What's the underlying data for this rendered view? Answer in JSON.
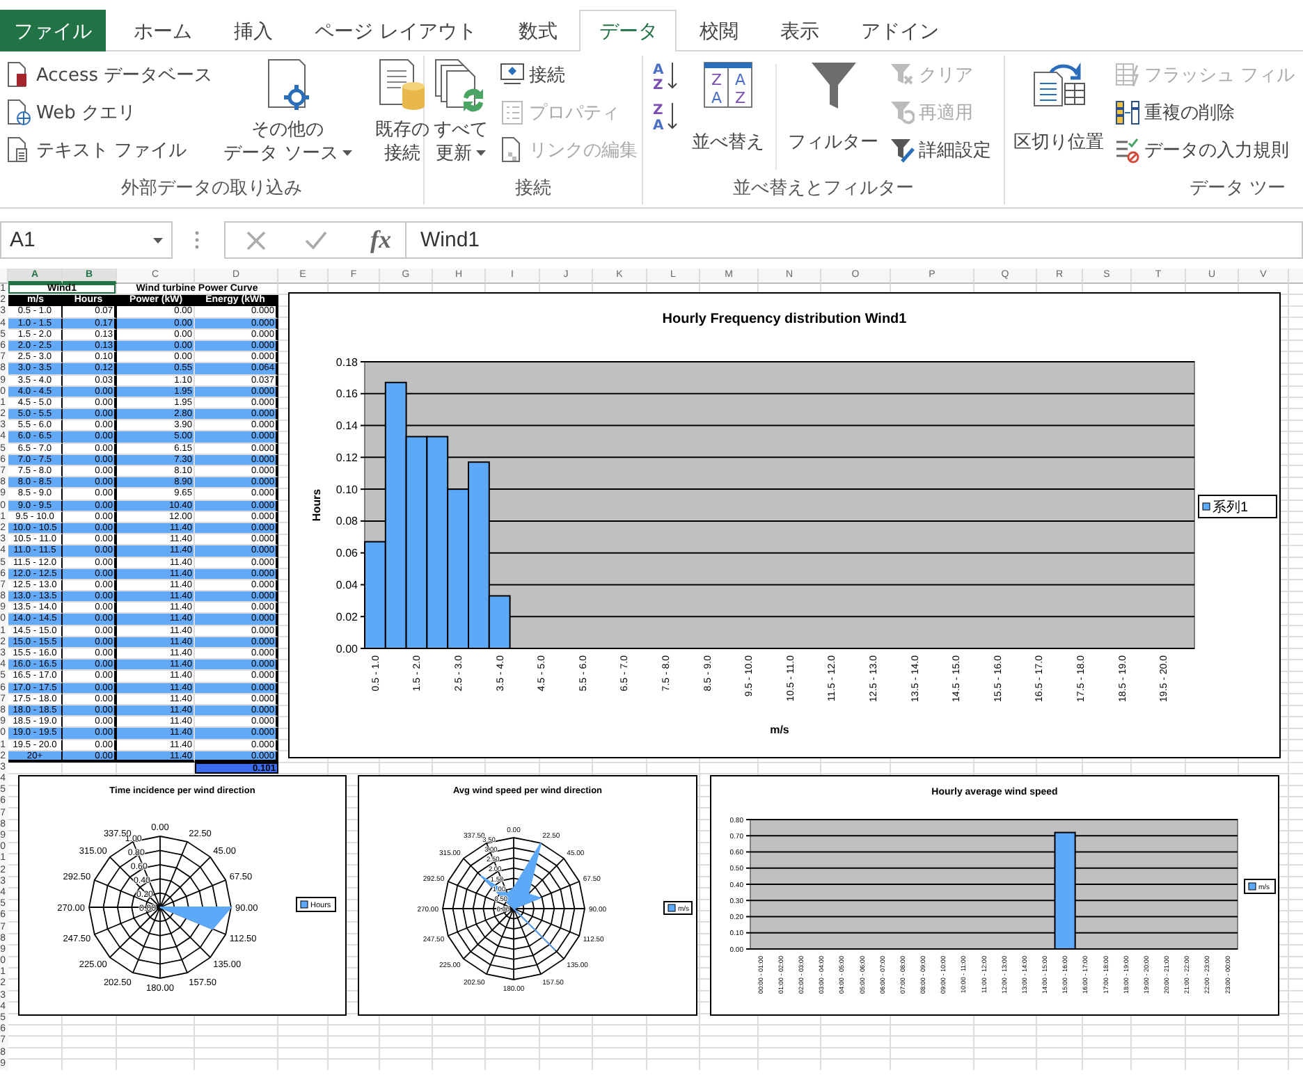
{
  "tabs": [
    {
      "label": "ファイル",
      "kind": "file",
      "selected": false
    },
    {
      "label": "ホーム",
      "kind": "tab",
      "selected": false
    },
    {
      "label": "挿入",
      "kind": "tab",
      "selected": false
    },
    {
      "label": "ページ レイアウト",
      "kind": "tab",
      "selected": false
    },
    {
      "label": "数式",
      "kind": "tab",
      "selected": false
    },
    {
      "label": "データ",
      "kind": "tab",
      "selected": true
    },
    {
      "label": "校閲",
      "kind": "tab",
      "selected": false
    },
    {
      "label": "表示",
      "kind": "tab",
      "selected": false
    },
    {
      "label": "アドイン",
      "kind": "tab",
      "selected": false
    }
  ],
  "ribbon": {
    "groups": [
      {
        "label": "外部データの取り込み",
        "items": [
          {
            "kind": "small",
            "label": "Access データベース",
            "disabled": false
          },
          {
            "kind": "small",
            "label": "Web クエリ",
            "disabled": false
          },
          {
            "kind": "small",
            "label": "テキスト ファイル",
            "disabled": false
          },
          {
            "kind": "large",
            "lines": [
              "その他の",
              "データ ソース"
            ],
            "dropdown": true,
            "disabled": false
          },
          {
            "kind": "large",
            "lines": [
              "既存の",
              "接続"
            ],
            "dropdown": false,
            "disabled": false
          }
        ]
      },
      {
        "label": "接続",
        "items": [
          {
            "kind": "large",
            "lines": [
              "すべて",
              "更新"
            ],
            "dropdown": true,
            "disabled": false
          },
          {
            "kind": "small",
            "label": "接続",
            "disabled": false
          },
          {
            "kind": "small",
            "label": "プロパティ",
            "disabled": true
          },
          {
            "kind": "small",
            "label": "リンクの編集",
            "disabled": true
          }
        ]
      },
      {
        "label": "並べ替えとフィルター",
        "items": [
          {
            "kind": "sort",
            "letters": [
              "A",
              "Z"
            ],
            "disabled": false
          },
          {
            "kind": "sort",
            "letters": [
              "Z",
              "A"
            ],
            "disabled": false
          },
          {
            "kind": "large",
            "lines": [
              "並べ替え"
            ],
            "letters": [
              "Z",
              "A",
              "A",
              "Z"
            ],
            "dropdown": false,
            "disabled": false
          },
          {
            "kind": "large",
            "lines": [
              "フィルター"
            ],
            "dropdown": false,
            "disabled": false
          },
          {
            "kind": "small",
            "label": "クリア",
            "disabled": true
          },
          {
            "kind": "small",
            "label": "再適用",
            "disabled": true
          },
          {
            "kind": "small",
            "label": "詳細設定",
            "disabled": false
          }
        ]
      },
      {
        "label": "データ ツー",
        "items": [
          {
            "kind": "large",
            "lines": [
              "区切り位置"
            ],
            "dropdown": false,
            "disabled": false
          },
          {
            "kind": "small",
            "label": "フラッシュ フィル",
            "disabled": true
          },
          {
            "kind": "small",
            "label": "重複の削除",
            "disabled": false
          },
          {
            "kind": "small",
            "label": "データの入力規則",
            "disabled": false
          }
        ]
      }
    ]
  },
  "formula_bar": {
    "name_box": "A1",
    "function_label": "fx",
    "value": "Wind1"
  },
  "sheet": {
    "columns": [
      {
        "label": "A",
        "selected": true
      },
      {
        "label": "B",
        "selected": true
      },
      {
        "label": "C",
        "selected": false
      },
      {
        "label": "D",
        "selected": false
      },
      {
        "label": "E",
        "selected": false
      },
      {
        "label": "F",
        "selected": false
      },
      {
        "label": "G",
        "selected": false
      },
      {
        "label": "H",
        "selected": false
      },
      {
        "label": "I",
        "selected": false
      },
      {
        "label": "J",
        "selected": false
      },
      {
        "label": "K",
        "selected": false
      },
      {
        "label": "L",
        "selected": false
      },
      {
        "label": "M",
        "selected": false
      },
      {
        "label": "N",
        "selected": false
      },
      {
        "label": "O",
        "selected": false
      },
      {
        "label": "P",
        "selected": false
      },
      {
        "label": "Q",
        "selected": false
      },
      {
        "label": "R",
        "selected": false
      },
      {
        "label": "S",
        "selected": false
      },
      {
        "label": "T",
        "selected": false
      },
      {
        "label": "U",
        "selected": false
      },
      {
        "label": "V",
        "selected": false
      }
    ],
    "row_headers": [
      "1",
      "2",
      "3",
      "4",
      "5",
      "6",
      "7",
      "8",
      "9",
      "0",
      "1",
      "2",
      "3",
      "4",
      "5",
      "6",
      "7",
      "8",
      "9",
      "0",
      "1",
      "2",
      "3",
      "4",
      "5",
      "6",
      "7",
      "8",
      "9",
      "0",
      "1",
      "2",
      "3",
      "4",
      "5",
      "6",
      "7",
      "8",
      "9",
      "0",
      "1",
      "2",
      "3",
      "4",
      "5",
      "6",
      "7",
      "8",
      "9",
      "0",
      "1",
      "2",
      "3",
      "4",
      "5",
      "6",
      "7",
      "8",
      "9",
      "0",
      "1",
      "2",
      "3",
      "4",
      "5",
      "6",
      "7",
      "8",
      "9"
    ],
    "table": {
      "titles": [
        {
          "text": "Wind1",
          "selected": true
        },
        {
          "text": "Wind turbine Power Curve",
          "selected": false
        }
      ],
      "columns": [
        "m/s",
        "Hours",
        "Power (kW)",
        "Energy (kWh"
      ],
      "rows": [
        [
          "0.5 - 1.0",
          "0.07",
          "0.00",
          "0.000"
        ],
        [
          "1.0 - 1.5",
          "0.17",
          "0.00",
          "0.000"
        ],
        [
          "1.5 - 2.0",
          "0.13",
          "0.00",
          "0.000"
        ],
        [
          "2.0 - 2.5",
          "0.13",
          "0.00",
          "0.000"
        ],
        [
          "2.5 - 3.0",
          "0.10",
          "0.00",
          "0.000"
        ],
        [
          "3.0 - 3.5",
          "0.12",
          "0.55",
          "0.064"
        ],
        [
          "3.5 - 4.0",
          "0.03",
          "1.10",
          "0.037"
        ],
        [
          "4.0 - 4.5",
          "0.00",
          "1.95",
          "0.000"
        ],
        [
          "4.5 - 5.0",
          "0.00",
          "1.95",
          "0.000"
        ],
        [
          "5.0 - 5.5",
          "0.00",
          "2.80",
          "0.000"
        ],
        [
          "5.5 - 6.0",
          "0.00",
          "3.90",
          "0.000"
        ],
        [
          "6.0 - 6.5",
          "0.00",
          "5.00",
          "0.000"
        ],
        [
          "6.5 - 7.0",
          "0.00",
          "6.15",
          "0.000"
        ],
        [
          "7.0 - 7.5",
          "0.00",
          "7.30",
          "0.000"
        ],
        [
          "7.5 - 8.0",
          "0.00",
          "8.10",
          "0.000"
        ],
        [
          "8.0 - 8.5",
          "0.00",
          "8.90",
          "0.000"
        ],
        [
          "8.5 - 9.0",
          "0.00",
          "9.65",
          "0.000"
        ],
        [
          "9.0 - 9.5",
          "0.00",
          "10.40",
          "0.000"
        ],
        [
          "9.5 - 10.0",
          "0.00",
          "12.00",
          "0.000"
        ],
        [
          "10.0 - 10.5",
          "0.00",
          "11.40",
          "0.000"
        ],
        [
          "10.5 - 11.0",
          "0.00",
          "11.40",
          "0.000"
        ],
        [
          "11.0 - 11.5",
          "0.00",
          "11.40",
          "0.000"
        ],
        [
          "11.5 - 12.0",
          "0.00",
          "11.40",
          "0.000"
        ],
        [
          "12.0 - 12.5",
          "0.00",
          "11.40",
          "0.000"
        ],
        [
          "12.5 - 13.0",
          "0.00",
          "11.40",
          "0.000"
        ],
        [
          "13.0 - 13.5",
          "0.00",
          "11.40",
          "0.000"
        ],
        [
          "13.5 - 14.0",
          "0.00",
          "11.40",
          "0.000"
        ],
        [
          "14.0 - 14.5",
          "0.00",
          "11.40",
          "0.000"
        ],
        [
          "14.5 - 15.0",
          "0.00",
          "11.40",
          "0.000"
        ],
        [
          "15.0 - 15.5",
          "0.00",
          "11.40",
          "0.000"
        ],
        [
          "15.5 - 16.0",
          "0.00",
          "11.40",
          "0.000"
        ],
        [
          "16.0 - 16.5",
          "0.00",
          "11.40",
          "0.000"
        ],
        [
          "16.5 - 17.0",
          "0.00",
          "11.40",
          "0.000"
        ],
        [
          "17.0 - 17.5",
          "0.00",
          "11.40",
          "0.000"
        ],
        [
          "17.5 - 18.0",
          "0.00",
          "11.40",
          "0.000"
        ],
        [
          "18.0 - 18.5",
          "0.00",
          "11.40",
          "0.000"
        ],
        [
          "18.5 - 19.0",
          "0.00",
          "11.40",
          "0.000"
        ],
        [
          "19.0 - 19.5",
          "0.00",
          "11.40",
          "0.000"
        ],
        [
          "19.5 - 20.0",
          "0.00",
          "11.40",
          "0.000"
        ],
        [
          "20+",
          "0.00",
          "11.40",
          "0.000"
        ]
      ],
      "total": "0.101"
    },
    "charts": [
      {
        "kind": "chart",
        "chart_data": {
          "type": "bar",
          "title": "Hourly Frequency distribution Wind1",
          "xlabel": "m/s",
          "ylabel": "Hours",
          "grid": true,
          "categories": [
            "0.5 - 1.0",
            null,
            "1.5 - 2.0",
            null,
            "2.5 - 3.0",
            null,
            "3.5 - 4.0",
            null,
            "4.5 - 5.0",
            null,
            "5.5 - 6.0",
            null,
            "6.5 - 7.0",
            null,
            "7.5 - 8.0",
            null,
            "8.5 - 9.0",
            null,
            "9.5 - 10.0",
            null,
            "10.5 - 11.0",
            null,
            "11.5 - 12.0",
            null,
            "12.5 - 13.0",
            null,
            "13.5 - 14.0",
            null,
            "14.5 - 15.0",
            null,
            "15.5 - 16.0",
            null,
            "16.5 - 17.0",
            null,
            "17.5 - 18.0",
            null,
            "18.5 - 19.0",
            null,
            "19.5 - 20.0",
            null
          ],
          "series": [
            {
              "name": "系列1",
              "color": "#5ea8f8",
              "values": [
                0.067,
                0.167,
                0.133,
                0.133,
                0.1,
                0.117,
                0.033,
                0,
                0,
                0,
                0,
                0,
                0,
                0,
                0,
                0,
                0,
                0,
                0,
                0,
                0,
                0,
                0,
                0,
                0,
                0,
                0,
                0,
                0,
                0,
                0,
                0,
                0,
                0,
                0,
                0,
                0,
                0,
                0,
                0
              ]
            }
          ],
          "ylim": [
            0,
            0.18
          ],
          "yticks": [
            {
              "value": 0,
              "label": "0.00"
            },
            {
              "value": 0.02,
              "label": "0.02"
            },
            {
              "value": 0.04,
              "label": "0.04"
            },
            {
              "value": 0.06,
              "label": "0.06"
            },
            {
              "value": 0.08,
              "label": "0.08"
            },
            {
              "value": 0.1,
              "label": "0.10"
            },
            {
              "value": 0.12,
              "label": "0.12"
            },
            {
              "value": 0.14,
              "label": "0.14"
            },
            {
              "value": 0.16,
              "label": "0.16"
            },
            {
              "value": 0.18,
              "label": "0.18"
            }
          ]
        }
      },
      {
        "kind": "radar",
        "title": "Time incidence per wind direction",
        "directions": [
          "0.00",
          "22.50",
          "45.00",
          "67.50",
          "90.00",
          "112.50",
          "135.00",
          "157.50",
          "180.00",
          "202.50",
          "225.00",
          "247.50",
          "270.00",
          "292.50",
          "315.00",
          "337.50"
        ],
        "rings": [
          "1.00",
          "0.80",
          "0.60",
          "0.40",
          "0.20",
          "0.00"
        ],
        "legend": "Hours"
      },
      {
        "kind": "radar",
        "title": "Avg wind speed per wind direction",
        "directions": [
          "0.00",
          "22.50",
          "45.00",
          "67.50",
          "90.00",
          "112.50",
          "135.00",
          "157.50",
          "180.00",
          "202.50",
          "225.00",
          "247.50",
          "270.00",
          "292.50",
          "315.00",
          "337.50"
        ],
        "rings": [
          "3.50",
          "3.00",
          "2.50",
          "2.00",
          "1.50",
          "1.00",
          "0.50",
          "0.00"
        ],
        "legend": "m/s"
      },
      {
        "kind": "chart",
        "chart_data": {
          "type": "bar",
          "title": "Hourly average wind speed",
          "grid": true,
          "categories": [
            "00:00 - 01:00",
            "01:00 - 02:00",
            "02:00 - 03:00",
            "03:00 - 04:00",
            "04:00 - 05:00",
            "05:00 - 06:00",
            "06:00 - 07:00",
            "07:00 - 08:00",
            "08:00 - 09:00",
            "09:00 - 10:00",
            "10:00 - 11:00",
            "11:00 - 12:00",
            "12:00 - 13:00",
            "13:00 - 14:00",
            "14:00 - 15:00",
            "15:00 - 16:00",
            "16:00 - 17:00",
            "17:00 - 18:00",
            "18:00 - 19:00",
            "19:00 - 20:00",
            "20:00 - 21:00",
            "21:00 - 22:00",
            "22:00 - 23:00",
            "23:00 - 00:00"
          ],
          "series": [
            {
              "name": "m/s",
              "color": "#5ea8f8",
              "values": [
                0,
                0,
                0,
                0,
                0,
                0,
                0,
                0,
                0,
                0,
                0,
                0,
                0,
                0,
                0,
                0.72,
                0,
                0,
                0,
                0,
                0,
                0,
                0,
                0
              ]
            }
          ],
          "ylim": [
            0,
            0.8
          ],
          "yticks": [
            {
              "value": 0,
              "label": "0.00"
            },
            {
              "value": 0.1,
              "label": "0.10"
            },
            {
              "value": 0.2,
              "label": "0.20"
            },
            {
              "value": 0.3,
              "label": "0.30"
            },
            {
              "value": 0.4,
              "label": "0.40"
            },
            {
              "value": 0.5,
              "label": "0.50"
            },
            {
              "value": 0.6,
              "label": "0.60"
            },
            {
              "value": 0.7,
              "label": "0.70"
            },
            {
              "value": 0.8,
              "label": "0.80"
            }
          ]
        }
      }
    ]
  }
}
